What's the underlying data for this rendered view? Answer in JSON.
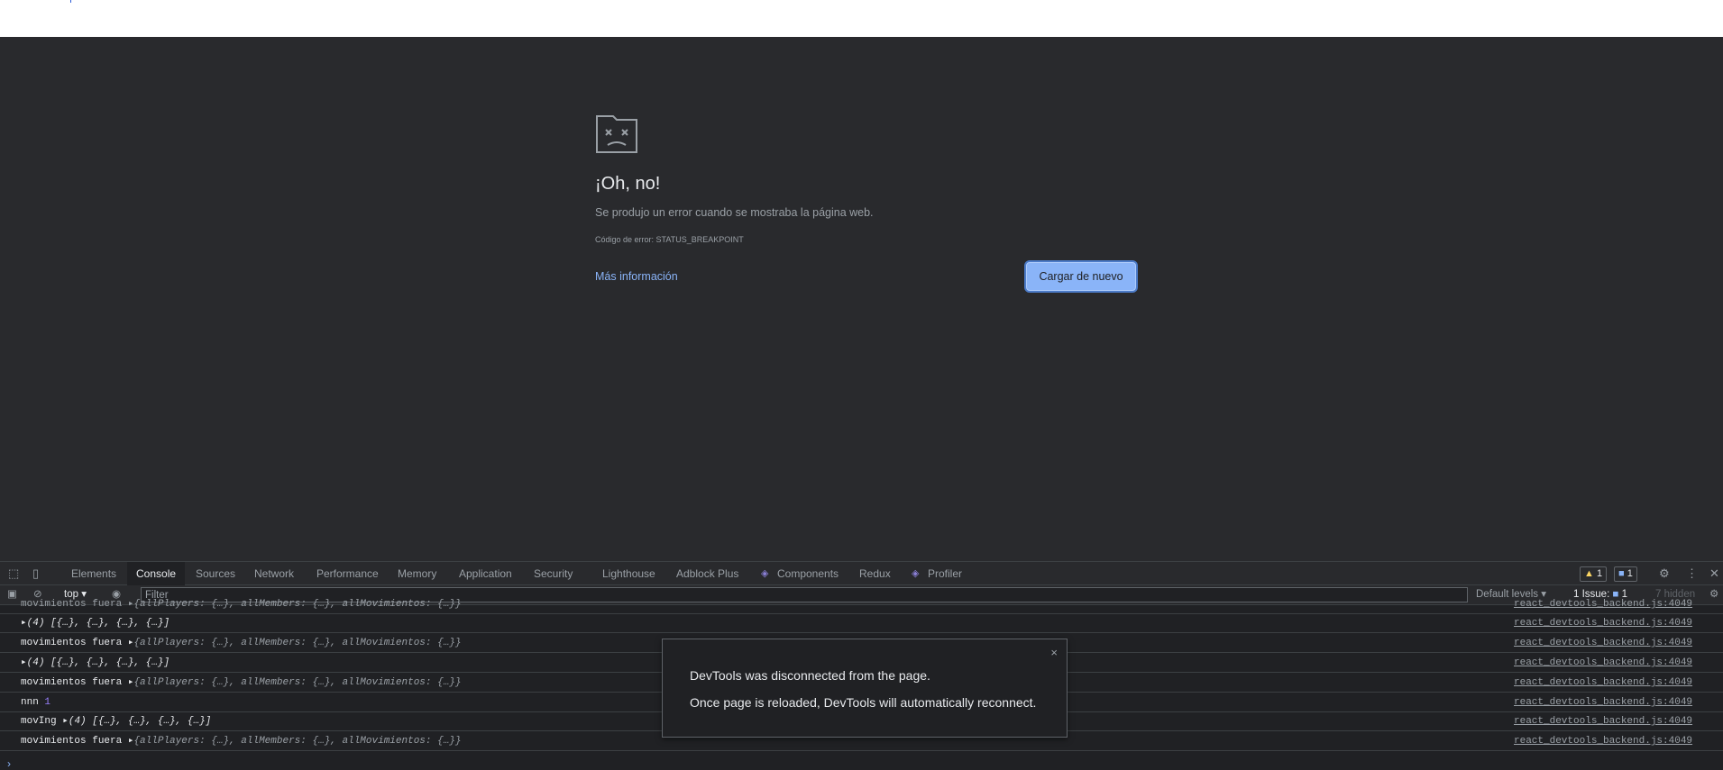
{
  "error_page": {
    "icon": "sad-folder-icon",
    "title": "¡Oh, no!",
    "description": "Se produjo un error cuando se mostraba la página web.",
    "error_code": "Código de error: STATUS_BREAKPOINT",
    "more_info": "Más información",
    "reload": "Cargar de nuevo"
  },
  "devtools": {
    "tabs": [
      "Elements",
      "Console",
      "Sources",
      "Network",
      "Performance",
      "Memory",
      "Application",
      "Security",
      "Lighthouse",
      "Adblock Plus",
      "Components",
      "Redux",
      "Profiler"
    ],
    "active_tab": "Console",
    "warnings": "1",
    "messages": "1",
    "filter": {
      "context": "top",
      "placeholder": "Filter",
      "levels": "Default levels",
      "issues_label": "1 Issue:",
      "issues_count": "1",
      "hidden": "7 hidden"
    },
    "rows": [
      {
        "label": "movimientos fuera",
        "value": "{allPlayers: {…}, allMembers: {…}, allMovimientos: {…}}",
        "source": "react_devtools_backend.js:4049"
      },
      {
        "label": "",
        "value": "(4) [{…}, {…}, {…}, {…}]",
        "source": "react_devtools_backend.js:4049"
      },
      {
        "label": "movimientos fuera",
        "value": "{allPlayers: {…}, allMembers: {…}, allMovimientos: {…}}",
        "source": "react_devtools_backend.js:4049"
      },
      {
        "label": "",
        "value": "(4) [{…}, {…}, {…}, {…}]",
        "source": "react_devtools_backend.js:4049"
      },
      {
        "label": "movimientos fuera",
        "value": "{allPlayers: {…}, allMembers: {…}, allMovimientos: {…}}",
        "source": "react_devtools_backend.js:4049"
      },
      {
        "label": "nnn",
        "value": "1",
        "source": "react_devtools_backend.js:4049"
      },
      {
        "label": "movIng",
        "value": "(4) [{…}, {…}, {…}, {…}]",
        "source": "react_devtools_backend.js:4049"
      },
      {
        "label": "movimientos fuera",
        "value": "{allPlayers: {…}, allMembers: {…}, allMovimientos: {…}}",
        "source": "react_devtools_backend.js:4049"
      }
    ]
  },
  "toast": {
    "line1": "DevTools was disconnected from the page.",
    "line2": "Once page is reloaded, DevTools will automatically reconnect."
  },
  "colors": {
    "page_bg": "#292a2d",
    "accent": "#8ab4f8",
    "text": "#e8eaed",
    "muted": "#9aa0a6"
  }
}
